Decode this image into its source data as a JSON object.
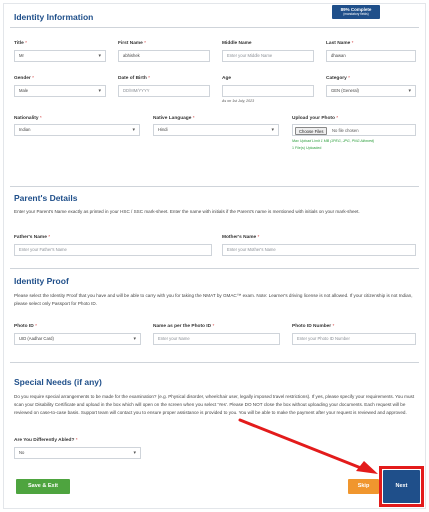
{
  "progress": {
    "percent_label": "89% Complete",
    "sub_label": "(mandatory fields)"
  },
  "identity": {
    "title": "Identity Information",
    "fields": {
      "title": {
        "label": "Title",
        "value": "Mr"
      },
      "first_name": {
        "label": "First Name",
        "value": "abhishek"
      },
      "middle_name": {
        "label": "Middle Name",
        "placeholder": "Enter your Middle Name"
      },
      "last_name": {
        "label": "Last Name",
        "value": "dhawan"
      },
      "gender": {
        "label": "Gender",
        "value": "Male"
      },
      "dob": {
        "label": "Date of Birth",
        "placeholder": "DD/MM/YYYY"
      },
      "age": {
        "label": "Age",
        "note": "As on 1st July, 2023"
      },
      "category": {
        "label": "Category",
        "value": "GEN (General)"
      },
      "nationality": {
        "label": "Nationality",
        "value": "Indian"
      },
      "native_language": {
        "label": "Native Language",
        "value": "Hindi"
      },
      "photo": {
        "label": "Upload your Photo",
        "button": "Choose Files",
        "file_text": "No file chosen",
        "note": "Max Upload Limit 1 MB (JPEG, JPG, PNG Allowed)",
        "uploaded": "1 File(s) Uploaded"
      }
    }
  },
  "parents": {
    "title": "Parent's Details",
    "instructions": "Enter your Parent's Name exactly as printed in your HSC / SSC mark-sheet. Enter the name with initials if the Parent's name is mentioned with initials on your mark-sheet.",
    "father": {
      "label": "Father's Name",
      "placeholder": "Enter your Father's Name"
    },
    "mother": {
      "label": "Mother's Name",
      "placeholder": "Enter your Mother's Name"
    }
  },
  "proof": {
    "title": "Identity Proof",
    "instructions": "Please select the Identity Proof that you have and will be able to carry with you for taking the NMAT by GMAC™ exam. Note: Learner's driving license is not allowed. If your citizenship is not Indian, please select only Passport for Photo ID.",
    "photo_id": {
      "label": "Photo ID",
      "value": "UID (Aadhar Card)"
    },
    "name_on_id": {
      "label": "Name as per the Photo ID",
      "placeholder": "Enter your Name"
    },
    "id_number": {
      "label": "Photo ID Number",
      "placeholder": "Enter your Photo ID Number"
    }
  },
  "special": {
    "title": "Special Needs (if any)",
    "instructions": "Do you require special arrangements to be made for the examination? (e.g. Physical disorder, wheelchair user, legally imposed travel restrictions). If yes, please specify your requirements. You must scan your Disability Certificate and upload in the box which will open on the screen when you select 'Yes'. Please DO NOT close the box without uploading your documents. Each request will be reviewed on case-to-case basis. Support team will contact you to ensure proper assistance is provided to you. You will be able to make the payment after your request is reviewed and approved.",
    "differently_abled": {
      "label": "Are You Differently Abled?",
      "value": "No"
    }
  },
  "actions": {
    "save_exit": "Save & Exit",
    "skip": "Skip",
    "next": "Next"
  },
  "required_mark": "*",
  "colors": {
    "brand": "#1f4f8a",
    "save": "#4ea43f",
    "skip": "#f0962e",
    "highlight": "#e31b1b",
    "required": "#d23b3b"
  }
}
